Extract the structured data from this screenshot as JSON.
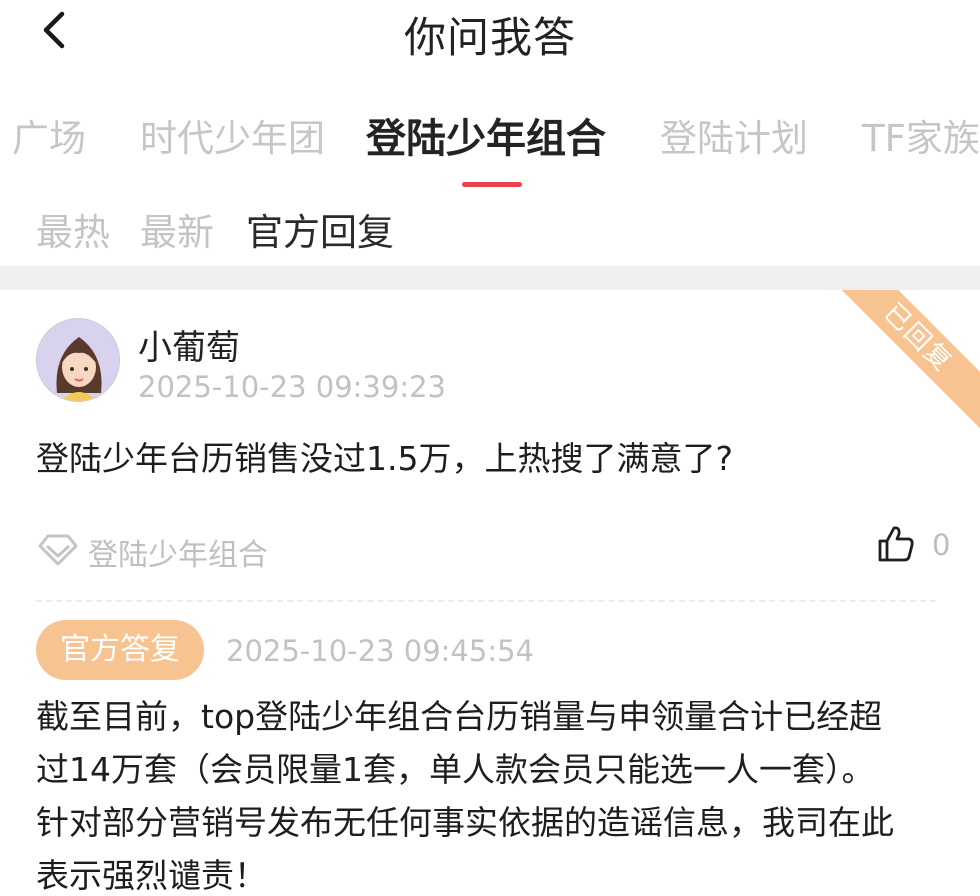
{
  "header": {
    "title": "你问我答"
  },
  "tabs": [
    {
      "label": "广场"
    },
    {
      "label": "时代少年团"
    },
    {
      "label": "登陆少年组合"
    },
    {
      "label": "登陆计划"
    },
    {
      "label": "TF家族"
    }
  ],
  "subtabs": [
    {
      "label": "最热"
    },
    {
      "label": "最新"
    },
    {
      "label": "官方回复"
    }
  ],
  "post": {
    "ribbon": "已回复",
    "username": "小葡萄",
    "time": "2025-10-23 09:39:23",
    "question": "登陆少年台历销售没过1.5万，上热搜了满意了?",
    "tag": "登陆少年组合",
    "likes": "0",
    "reply": {
      "badge": "官方答复",
      "time": "2025-10-23 09:45:54",
      "lines": [
        "截至目前，top登陆少年组合台历销量与申领量合计已经超",
        "过14万套（会员限量1套，单人款会员只能选一人一套）。",
        "针对部分营销号发布无任何事实依据的造谣信息，我司在此",
        "表示强烈谴责！"
      ]
    }
  },
  "colors": {
    "accent": "#e8414f",
    "badge": "#f7c391",
    "muted": "#c2c2c2"
  }
}
